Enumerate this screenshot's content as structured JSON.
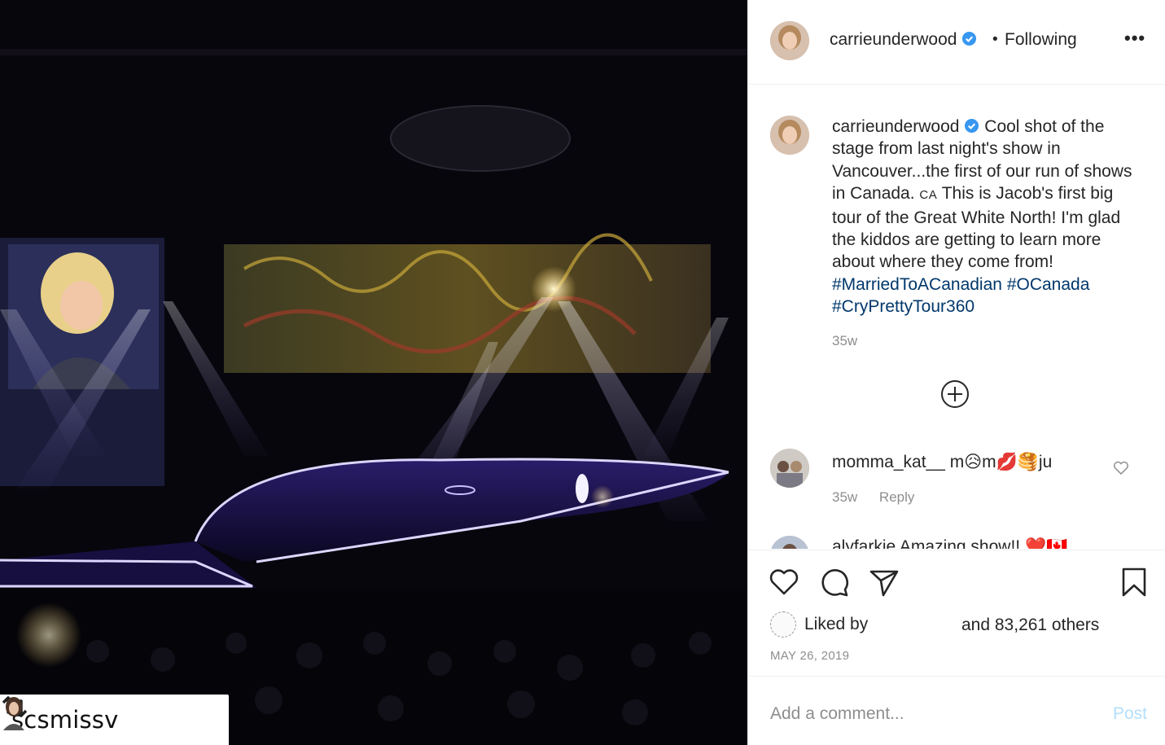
{
  "post": {
    "author": "carrieunderwood",
    "follow_status": "Following",
    "separator": "•",
    "more_label": "•••",
    "repost_username": "scsmissv"
  },
  "caption": {
    "username": "carrieunderwood",
    "text_1": "Cool shot of the stage from last night's show in Vancouver...the first of our run of shows in Canada.",
    "flag": "CA",
    "text_2": "This is Jacob's first big tour of the Great White North! I'm glad the kiddos are getting to learn more about where they come from!",
    "hashtags": [
      "#MarriedToACanadian",
      "#OCanada",
      "#CryPrettyTour360"
    ],
    "age": "35w"
  },
  "comments": [
    {
      "username": "momma_kat__",
      "text": "m😥m💋🥞ju",
      "age": "35w",
      "reply_label": "Reply"
    },
    {
      "username": "alyfarkie",
      "text": "Amazing show!! ❤️🇨🇦"
    }
  ],
  "likes": {
    "liked_by_label": "Liked by",
    "others_label": "and 83,261 others"
  },
  "date": "MAY 26, 2019",
  "comment_box": {
    "placeholder": "Add a comment...",
    "post_label": "Post"
  },
  "colors": {
    "link": "#00376b",
    "verified": "#3897f0",
    "muted": "#8e8e8e",
    "post_disabled": "#b2dffc"
  }
}
